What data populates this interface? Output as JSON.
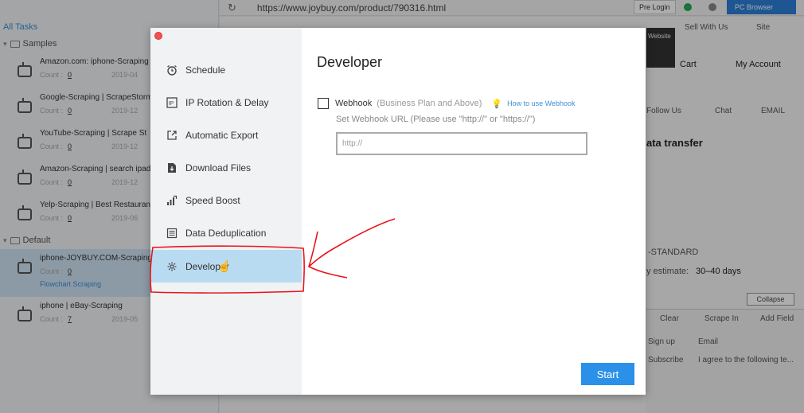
{
  "sidebar": {
    "header": "All Tasks",
    "groups": [
      {
        "label": "Samples"
      },
      {
        "label": "Default"
      }
    ],
    "tasks": [
      {
        "title": "Amazon.com: iphone-Scraping",
        "count_label": "Count :",
        "count": "0",
        "date": "2019-04"
      },
      {
        "title": "Google-Scraping | ScrapeStorm",
        "count_label": "Count :",
        "count": "0",
        "date": "2019-12"
      },
      {
        "title": "YouTube-Scraping | Scrape St",
        "count_label": "Count :",
        "count": "0",
        "date": "2019-12"
      },
      {
        "title": "Amazon-Scraping | search ipad",
        "count_label": "Count :",
        "count": "0",
        "date": "2019-12"
      },
      {
        "title": "Yelp-Scraping | Best Restaurant",
        "count_label": "Count :",
        "count": "0",
        "date": "2019-06"
      },
      {
        "title": "iphone-JOYBUY.COM-Scraping",
        "count_label": "Count :",
        "count": "0",
        "date": "",
        "sub": "Flowchart Scraping"
      },
      {
        "title": "iphone | eBay-Scraping",
        "count_label": "Count :",
        "count": "7",
        "date": "2019-05"
      }
    ]
  },
  "browser": {
    "url": "https://www.joybuy.com/product/790316.html",
    "pre_login": "Pre Login",
    "pc_browser": "PC Browser"
  },
  "site": {
    "website_tip": "Website",
    "sell_with_us": "Sell With Us",
    "site": "Site",
    "cart": "Cart",
    "my_account": "My Account",
    "follow_us": "Follow Us",
    "chat": "Chat",
    "email": "EMAIL",
    "heading": "ata transfer",
    "standard": "-STANDARD",
    "estimate_label": "y estimate:",
    "estimate_value": "30–40 days",
    "collapse": "Collapse",
    "clear": "Clear",
    "scrape_in": "Scrape In",
    "add_field": "Add Field",
    "col_signup": "Sign up",
    "col_email": "Email",
    "cell_subscribe": "Subscribe",
    "cell_agree": "I agree to the following te..."
  },
  "modal": {
    "nav": [
      {
        "label": "Schedule",
        "icon": "alarm-clock-icon"
      },
      {
        "label": "IP Rotation & Delay",
        "icon": "ip-icon"
      },
      {
        "label": "Automatic Export",
        "icon": "export-icon"
      },
      {
        "label": "Download Files",
        "icon": "download-file-icon"
      },
      {
        "label": "Speed Boost",
        "icon": "speed-bars-icon"
      },
      {
        "label": "Data Deduplication",
        "icon": "dedup-list-icon"
      },
      {
        "label": "Developer",
        "icon": "gear-icon"
      }
    ],
    "title": "Developer",
    "webhook": {
      "label": "Webhook",
      "plan": "(Business Plan and Above)",
      "link": "How to use Webhook",
      "hint": "Set Webhook URL  (Please use \"http://\" or \"https://\")",
      "placeholder": "http://"
    },
    "start": "Start"
  },
  "colors": {
    "accent": "#2b90e8",
    "nav_active": "#b9dbf2",
    "annotation": "#e8141a"
  }
}
